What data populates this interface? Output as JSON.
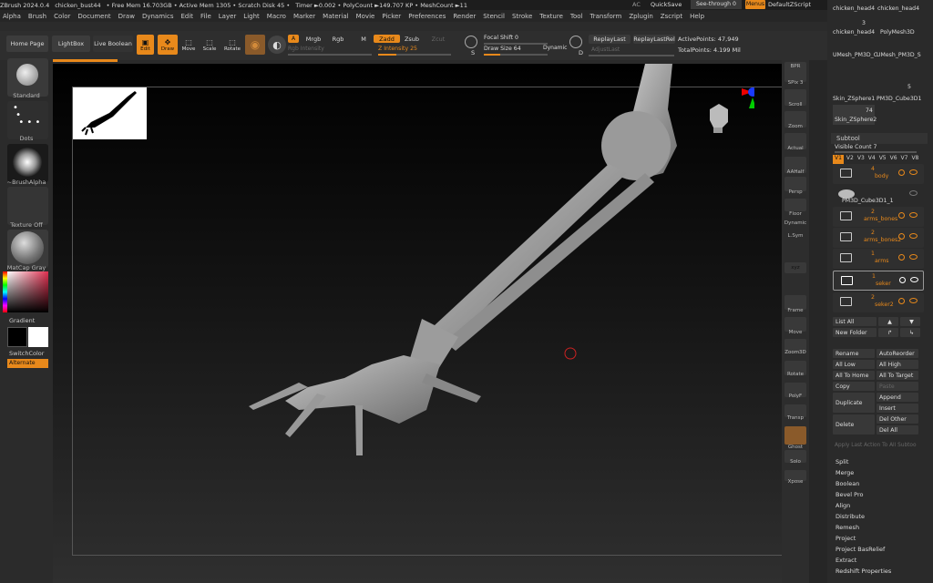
{
  "titlebar": {
    "items": [
      "ZBrush 2024.0.4",
      "chicken_bust44",
      "• Free Mem 16.703GB • Active Mem 1305 • Scratch Disk 45 •",
      "Timer ►0.002 • PolyCount ►149.707 KP • MeshCount ►11"
    ],
    "ac": "AC",
    "quicksave": "QuickSave",
    "seethrough": "See-through  0",
    "menus": "Menus",
    "default_zscript": "DefaultZScript"
  },
  "menubar": [
    "Alpha",
    "Brush",
    "Color",
    "Document",
    "Draw",
    "Dynamics",
    "Edit",
    "File",
    "Layer",
    "Light",
    "Macro",
    "Marker",
    "Material",
    "Movie",
    "Picker",
    "Preferences",
    "Render",
    "Stencil",
    "Stroke",
    "Texture",
    "Tool",
    "Transform",
    "Zplugin",
    "Zscript",
    "Help"
  ],
  "toolbar": {
    "home": "Home Page",
    "lightbox": "LightBox",
    "live_boolean": "Live Boolean",
    "edit": "Edit",
    "draw": "Draw",
    "move": "Move",
    "scale": "Scale",
    "rotate": "Rotate",
    "a": "A",
    "mrgb": "Mrgb",
    "rgb": "Rgb",
    "m": "M",
    "zadd": "Zadd",
    "zsub": "Zsub",
    "zcut": "Zcut",
    "rgb_intensity": "Rgb Intensity",
    "z_intensity": "Z Intensity 25",
    "focal_shift": "Focal Shift 0",
    "draw_size": "Draw Size 64",
    "dynamic": "Dynamic",
    "s": "S",
    "d": "D",
    "replay_last": "ReplayLast",
    "replay_last_rel": "ReplayLastRel",
    "adjust_last": "AdjustLast",
    "active_points": "ActivePoints: 47,949",
    "total_points": "TotalPoints: 4.199 Mil",
    "z_intensity_level": 0.25,
    "draw_size_level": 0.25
  },
  "left": {
    "standard": "Standard",
    "dots": "Dots",
    "brush_alpha": "~BrushAlpha",
    "texture_off": "Texture Off",
    "matcap": "MatCap Gray",
    "gradient": "Gradient",
    "switch_color": "SwitchColor",
    "alternate": "Alternate"
  },
  "right_strip": [
    "BPR",
    "SPix 3",
    "Scroll",
    "Zoom",
    "Actual",
    "AAHalf",
    "Persp",
    "Floor",
    "Dynamic",
    "L.Sym",
    "xyz",
    "Frame",
    "Move",
    "Zoom3D",
    "Rotate",
    "PolyF",
    "Transp",
    "Ghost",
    "Solo",
    "Xpose"
  ],
  "tool_palette": {
    "thumbs": [
      "chicken_head4",
      "chicken_head4",
      "chicken_head4",
      "PolyMesh3D",
      "UMesh_PM3D_C",
      "UMesh_PM3D_S",
      "Skin_ZSphere1",
      "PM3D_Cube3D1",
      "Skin_ZSphere2"
    ],
    "counts": [
      "3",
      "5",
      "74"
    ]
  },
  "subtool": {
    "title": "Subtool",
    "visible_count": "Visible Count 7",
    "tabs": [
      "V1",
      "V2",
      "V3",
      "V4",
      "V5",
      "V6",
      "V7",
      "V8"
    ],
    "rows": [
      {
        "num": "4",
        "name": "body"
      },
      {
        "num": "",
        "name": "PM3D_Cube3D1_1"
      },
      {
        "num": "2",
        "name": "arms_bones"
      },
      {
        "num": "2",
        "name": "arms_bones2"
      },
      {
        "num": "1",
        "name": "arms"
      },
      {
        "num": "1",
        "name": "seker"
      },
      {
        "num": "2",
        "name": "seker2"
      }
    ],
    "list_all": "List All",
    "new_folder": "New Folder",
    "rename": "Rename",
    "auto_reorder": "AutoReorder",
    "all_low": "All Low",
    "all_high": "All High",
    "all_to_home": "All To Home",
    "all_to_target": "All To Target",
    "copy": "Copy",
    "paste": "Paste",
    "duplicate": "Duplicate",
    "append": "Append",
    "insert": "Insert",
    "delete": "Delete",
    "del_other": "Del Other",
    "del_all": "Del All",
    "apply_last": "Apply Last Action To All Subtoo",
    "sections": [
      "Split",
      "Merge",
      "Boolean",
      "Bevel Pro",
      "Align",
      "Distribute",
      "Remesh",
      "Project",
      "Project BasRelief",
      "Extract",
      "Redshift Properties"
    ]
  },
  "colors": {
    "accent": "#e8891b",
    "panel": "#2a2a2a",
    "viewport": "#000000"
  }
}
